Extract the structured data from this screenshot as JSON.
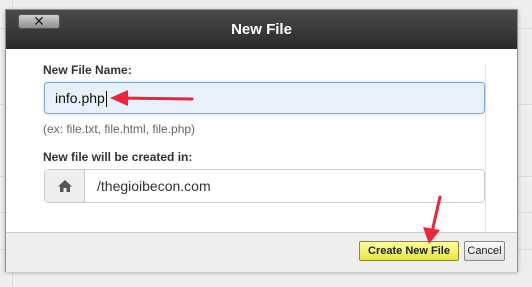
{
  "dialog": {
    "title": "New File",
    "close_label": "✕"
  },
  "form": {
    "file_name_label": "New File Name:",
    "file_name_value": "info.php",
    "file_name_hint": "(ex: file.txt, file.html, file.php)",
    "location_label": "New file will be created in:",
    "location_value": "/thegioibecon.com",
    "location_icon": "home-icon"
  },
  "footer": {
    "create_label": "Create New File",
    "cancel_label": "Cancel"
  },
  "colors": {
    "annotation_arrow": "#e8283a",
    "create_button": "#f0f070",
    "titlebar": "#333333"
  }
}
